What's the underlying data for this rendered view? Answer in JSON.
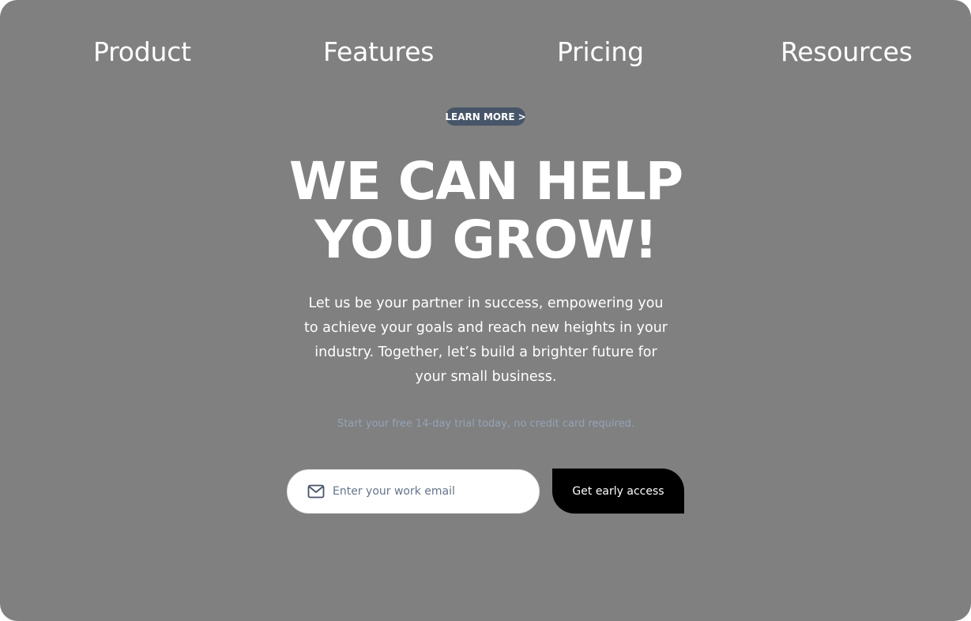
{
  "nav": {
    "items": [
      {
        "label": "Product"
      },
      {
        "label": "Features"
      },
      {
        "label": "Pricing"
      },
      {
        "label": "Resources"
      }
    ]
  },
  "hero": {
    "badge_label": "LEARN MORE",
    "badge_chevron": ">",
    "headline_line1": "WE CAN HELP",
    "headline_line2": "YOU GROW!",
    "subtext": "Let us be your partner in success, empowering you to achieve your goals and reach new heights in your industry. Together, let’s build a brighter future for your small business.",
    "trial_note": "Start your free 14-day trial today, no credit card required."
  },
  "signup": {
    "email_placeholder": "Enter your work email",
    "email_value": "",
    "cta_label": "Get early access",
    "mail_icon": "mail-icon"
  },
  "colors": {
    "background": "#808080",
    "badge": "#475569",
    "cta": "#000000",
    "text": "#ffffff",
    "muted": "#94a3b8"
  }
}
